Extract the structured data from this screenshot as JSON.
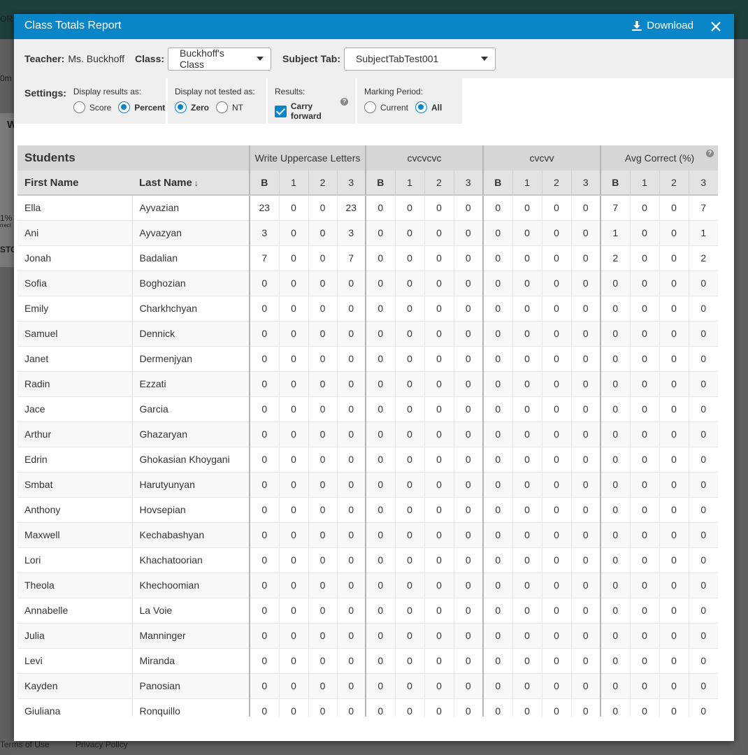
{
  "background": {
    "fragments": [
      "OR",
      "0m",
      "W",
      "1%",
      "rrect",
      "STO"
    ],
    "footer": [
      "Terms of Use",
      "Privacy Policy"
    ]
  },
  "modal": {
    "title": "Class Totals Report",
    "download_label": "Download",
    "icons": {
      "download": "download-icon",
      "close": "close-icon",
      "help": "help-icon"
    }
  },
  "filters": {
    "teacher_label": "Teacher:",
    "teacher_value": "Ms. Buckhoff",
    "class_label": "Class:",
    "class_value": "Buckhoff's Class",
    "subject_label": "Subject Tab:",
    "subject_value": "SubjectTabTest001"
  },
  "settings": {
    "title": "Settings:",
    "display_results": {
      "label": "Display results as:",
      "options": [
        "Score",
        "Percent"
      ],
      "selected": "Percent"
    },
    "display_not_tested": {
      "label": "Display not tested as:",
      "options": [
        "Zero",
        "NT"
      ],
      "selected": "Zero"
    },
    "results": {
      "label": "Results:",
      "checkbox_label": "Carry forward",
      "checked": true
    },
    "marking_period": {
      "label": "Marking Period:",
      "options": [
        "Current",
        "All"
      ],
      "selected": "All"
    }
  },
  "table": {
    "students_header": "Students",
    "first_name_header": "First Name",
    "last_name_header": "Last Name",
    "sort_indicator": "↓",
    "groups": [
      "Write Uppercase Letters",
      "cvcvcvc",
      "cvcvv",
      "Avg Correct (%)"
    ],
    "subcolumns": [
      "B",
      "1",
      "2",
      "3"
    ],
    "rows": [
      {
        "first": "Ella",
        "last": "Ayvazian",
        "values": [
          "23",
          "0",
          "0",
          "23",
          "0",
          "0",
          "0",
          "0",
          "0",
          "0",
          "0",
          "0",
          "7",
          "0",
          "0",
          "7"
        ]
      },
      {
        "first": "Ani",
        "last": "Ayvazyan",
        "values": [
          "3",
          "0",
          "0",
          "3",
          "0",
          "0",
          "0",
          "0",
          "0",
          "0",
          "0",
          "0",
          "1",
          "0",
          "0",
          "1"
        ]
      },
      {
        "first": "Jonah",
        "last": "Badalian",
        "values": [
          "7",
          "0",
          "0",
          "7",
          "0",
          "0",
          "0",
          "0",
          "0",
          "0",
          "0",
          "0",
          "2",
          "0",
          "0",
          "2"
        ]
      },
      {
        "first": "Sofia",
        "last": "Boghozian",
        "values": [
          "0",
          "0",
          "0",
          "0",
          "0",
          "0",
          "0",
          "0",
          "0",
          "0",
          "0",
          "0",
          "0",
          "0",
          "0",
          "0"
        ]
      },
      {
        "first": "Emily",
        "last": "Charkhchyan",
        "values": [
          "0",
          "0",
          "0",
          "0",
          "0",
          "0",
          "0",
          "0",
          "0",
          "0",
          "0",
          "0",
          "0",
          "0",
          "0",
          "0"
        ]
      },
      {
        "first": "Samuel",
        "last": "Dennick",
        "values": [
          "0",
          "0",
          "0",
          "0",
          "0",
          "0",
          "0",
          "0",
          "0",
          "0",
          "0",
          "0",
          "0",
          "0",
          "0",
          "0"
        ]
      },
      {
        "first": "Janet",
        "last": "Dermenjyan",
        "values": [
          "0",
          "0",
          "0",
          "0",
          "0",
          "0",
          "0",
          "0",
          "0",
          "0",
          "0",
          "0",
          "0",
          "0",
          "0",
          "0"
        ]
      },
      {
        "first": "Radin",
        "last": "Ezzati",
        "values": [
          "0",
          "0",
          "0",
          "0",
          "0",
          "0",
          "0",
          "0",
          "0",
          "0",
          "0",
          "0",
          "0",
          "0",
          "0",
          "0"
        ]
      },
      {
        "first": "Jace",
        "last": "Garcia",
        "values": [
          "0",
          "0",
          "0",
          "0",
          "0",
          "0",
          "0",
          "0",
          "0",
          "0",
          "0",
          "0",
          "0",
          "0",
          "0",
          "0"
        ]
      },
      {
        "first": "Arthur",
        "last": "Ghazaryan",
        "values": [
          "0",
          "0",
          "0",
          "0",
          "0",
          "0",
          "0",
          "0",
          "0",
          "0",
          "0",
          "0",
          "0",
          "0",
          "0",
          "0"
        ]
      },
      {
        "first": "Edrin",
        "last": "Ghokasian Khoygani",
        "values": [
          "0",
          "0",
          "0",
          "0",
          "0",
          "0",
          "0",
          "0",
          "0",
          "0",
          "0",
          "0",
          "0",
          "0",
          "0",
          "0"
        ]
      },
      {
        "first": "Smbat",
        "last": "Harutyunyan",
        "values": [
          "0",
          "0",
          "0",
          "0",
          "0",
          "0",
          "0",
          "0",
          "0",
          "0",
          "0",
          "0",
          "0",
          "0",
          "0",
          "0"
        ]
      },
      {
        "first": "Anthony",
        "last": "Hovsepian",
        "values": [
          "0",
          "0",
          "0",
          "0",
          "0",
          "0",
          "0",
          "0",
          "0",
          "0",
          "0",
          "0",
          "0",
          "0",
          "0",
          "0"
        ]
      },
      {
        "first": "Maxwell",
        "last": "Kechabashyan",
        "values": [
          "0",
          "0",
          "0",
          "0",
          "0",
          "0",
          "0",
          "0",
          "0",
          "0",
          "0",
          "0",
          "0",
          "0",
          "0",
          "0"
        ]
      },
      {
        "first": "Lori",
        "last": "Khachatoorian",
        "values": [
          "0",
          "0",
          "0",
          "0",
          "0",
          "0",
          "0",
          "0",
          "0",
          "0",
          "0",
          "0",
          "0",
          "0",
          "0",
          "0"
        ]
      },
      {
        "first": "Theola",
        "last": "Khechoomian",
        "values": [
          "0",
          "0",
          "0",
          "0",
          "0",
          "0",
          "0",
          "0",
          "0",
          "0",
          "0",
          "0",
          "0",
          "0",
          "0",
          "0"
        ]
      },
      {
        "first": "Annabelle",
        "last": "La Voie",
        "values": [
          "0",
          "0",
          "0",
          "0",
          "0",
          "0",
          "0",
          "0",
          "0",
          "0",
          "0",
          "0",
          "0",
          "0",
          "0",
          "0"
        ]
      },
      {
        "first": "Julia",
        "last": "Manninger",
        "values": [
          "0",
          "0",
          "0",
          "0",
          "0",
          "0",
          "0",
          "0",
          "0",
          "0",
          "0",
          "0",
          "0",
          "0",
          "0",
          "0"
        ]
      },
      {
        "first": "Levi",
        "last": "Miranda",
        "values": [
          "0",
          "0",
          "0",
          "0",
          "0",
          "0",
          "0",
          "0",
          "0",
          "0",
          "0",
          "0",
          "0",
          "0",
          "0",
          "0"
        ]
      },
      {
        "first": "Kayden",
        "last": "Panosian",
        "values": [
          "0",
          "0",
          "0",
          "0",
          "0",
          "0",
          "0",
          "0",
          "0",
          "0",
          "0",
          "0",
          "0",
          "0",
          "0",
          "0"
        ]
      },
      {
        "first": "Giuliana",
        "last": "Ronquillo",
        "values": [
          "0",
          "0",
          "0",
          "0",
          "0",
          "0",
          "0",
          "0",
          "0",
          "0",
          "0",
          "0",
          "0",
          "0",
          "0",
          "0"
        ]
      }
    ]
  },
  "colors": {
    "accent": "#0a86c8",
    "header_bg": "#d6d6d6",
    "filter_bg": "#efefef"
  }
}
